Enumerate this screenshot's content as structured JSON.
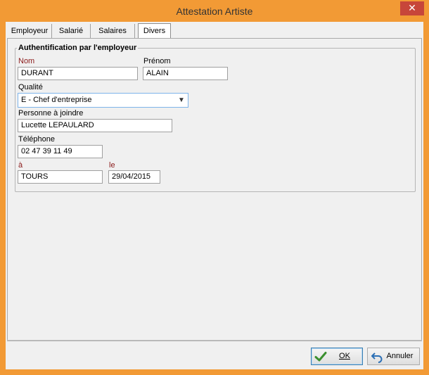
{
  "window": {
    "title": "Attestation Artiste",
    "close_glyph": "✕"
  },
  "tabs": [
    {
      "label": "Employeur"
    },
    {
      "label": "Salarié"
    },
    {
      "label": "Salaires"
    },
    {
      "label": "Divers",
      "active": true
    }
  ],
  "group": {
    "title": "Authentification par l'employeur",
    "nom": {
      "label": "Nom",
      "value": "DURANT"
    },
    "prenom": {
      "label": "Prénom",
      "value": "ALAIN"
    },
    "qualite": {
      "label": "Qualité",
      "value": "E - Chef d'entreprise"
    },
    "personne": {
      "label": "Personne à joindre",
      "value": "Lucette LEPAULARD"
    },
    "telephone": {
      "label": "Téléphone",
      "value": "02 47 39 11 49"
    },
    "lieu": {
      "label": "à",
      "value": "TOURS"
    },
    "date": {
      "label": "le",
      "value": "29/04/2015"
    }
  },
  "buttons": {
    "ok": {
      "label": "OK",
      "icon": "checkmark-icon"
    },
    "cancel": {
      "label": "Annuler",
      "icon": "undo-arrow-icon"
    }
  },
  "colors": {
    "titlebar": "#f29a35",
    "label_red": "#8b1a1a",
    "focus_border": "#7eb4ea"
  }
}
